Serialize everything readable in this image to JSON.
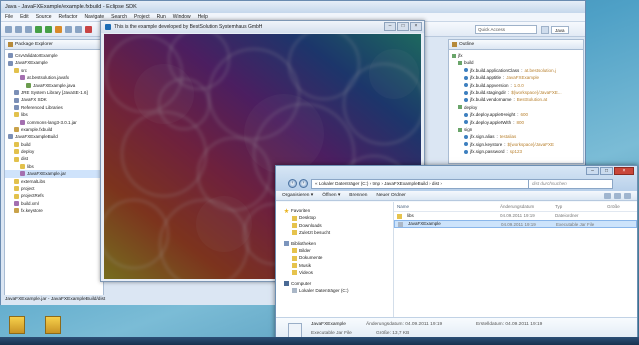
{
  "colors": {
    "eclipse_chrome": "#dbe6f3",
    "selection": "#cce3fb",
    "canvas_bg": "#000000",
    "desktop": "#4ea0c6"
  },
  "eclipse": {
    "title": "Java - JavaFXExample/example.fxbuild - Eclipse SDK",
    "menu": [
      "File",
      "Edit",
      "Source",
      "Refactor",
      "Navigate",
      "Search",
      "Project",
      "Run",
      "Window",
      "Help"
    ],
    "quick_access": "Quick Access",
    "perspective_label": "Java",
    "package_explorer": {
      "title": "Package Explorer",
      "items": [
        {
          "label": "CsvValidatorExample",
          "indent": 0,
          "icon": "project"
        },
        {
          "label": "JavaFXExample",
          "indent": 0,
          "icon": "project"
        },
        {
          "label": "src",
          "indent": 1,
          "icon": "folder"
        },
        {
          "label": "at.bestsolution.javafx",
          "indent": 2,
          "icon": "package"
        },
        {
          "label": "JavaFXExample.java",
          "indent": 3,
          "icon": "java"
        },
        {
          "label": "JRE System Library [JavaSE-1.6]",
          "indent": 1,
          "icon": "library"
        },
        {
          "label": "JavaFX SDK",
          "indent": 1,
          "icon": "library"
        },
        {
          "label": "Referenced Libraries",
          "indent": 1,
          "icon": "library"
        },
        {
          "label": "libs",
          "indent": 1,
          "icon": "folder"
        },
        {
          "label": "commons-lang3-3.0.1.jar",
          "indent": 2,
          "icon": "jar"
        },
        {
          "label": "example.fxbuild",
          "indent": 1,
          "icon": "file"
        },
        {
          "label": "JavaFXExampleBuild",
          "indent": 0,
          "icon": "project"
        },
        {
          "label": "build",
          "indent": 1,
          "icon": "folder"
        },
        {
          "label": "deploy",
          "indent": 1,
          "icon": "folder"
        },
        {
          "label": "dist",
          "indent": 1,
          "icon": "folder"
        },
        {
          "label": "libs",
          "indent": 2,
          "icon": "folder"
        },
        {
          "label": "JavaFXExample.jar",
          "indent": 2,
          "icon": "jar",
          "selected": true
        },
        {
          "label": "externalLibs",
          "indent": 1,
          "icon": "folder"
        },
        {
          "label": "project",
          "indent": 1,
          "icon": "folder"
        },
        {
          "label": "projectRefs",
          "indent": 1,
          "icon": "folder"
        },
        {
          "label": "build.xml",
          "indent": 1,
          "icon": "xml"
        },
        {
          "label": "fx.keystore",
          "indent": 1,
          "icon": "file"
        }
      ]
    },
    "outline": {
      "title": "Outline",
      "items": [
        {
          "label": "jfx",
          "value": "",
          "indent": 0,
          "node": true
        },
        {
          "label": "build",
          "value": "",
          "indent": 1,
          "node": true
        },
        {
          "label": "jfx.build.applicationClass",
          "value": "at.bestsolution.j",
          "indent": 2
        },
        {
          "label": "jfx.build.apptitle",
          "value": "JavaFXExample",
          "indent": 2
        },
        {
          "label": "jfx.build.appversion",
          "value": "1.0.0",
          "indent": 2
        },
        {
          "label": "jfx.build.stagingdir",
          "value": "${workspace}/JavaFXE...",
          "indent": 2
        },
        {
          "label": "jfx.build.vendorname",
          "value": "BestSolution.at",
          "indent": 2
        },
        {
          "label": "deploy",
          "value": "",
          "indent": 1,
          "node": true
        },
        {
          "label": "jfx.deploy.appletHeight",
          "value": "600",
          "indent": 2
        },
        {
          "label": "jfx.deploy.appletWith",
          "value": "800",
          "indent": 2
        },
        {
          "label": "sign",
          "value": "",
          "indent": 1,
          "node": true
        },
        {
          "label": "jfx.sign.alias",
          "value": "testalias",
          "indent": 2
        },
        {
          "label": "jfx.sign.keystore",
          "value": "${workspace}/JavaFXE",
          "indent": 2
        },
        {
          "label": "jfx.sign.password",
          "value": "sp123",
          "indent": 2
        }
      ]
    },
    "status": "JavaFXExample.jar - JavaFXExampleBuild/dist"
  },
  "fxwindow": {
    "title": "This is the example developed by BestSolution Systemhaus GmbH",
    "min_glyph": "–",
    "max_glyph": "□",
    "close_glyph": "×"
  },
  "explorer": {
    "address": "« Lokaler Datenträger (C:) › tmp › JavaFXExampleBuild › dist ›",
    "search_placeholder": "dist durchsuchen",
    "commands": [
      "Organisieren ▾",
      "Öffnen ▾",
      "Brennen",
      "Neuer Ordner"
    ],
    "nav_pane": [
      {
        "label": "Favoriten",
        "icon": "star",
        "head": true
      },
      {
        "label": "Desktop",
        "icon": "folder"
      },
      {
        "label": "Downloads",
        "icon": "folder"
      },
      {
        "label": "Zuletzt besucht",
        "icon": "folder"
      },
      {
        "label": "Bibliotheken",
        "icon": "lib",
        "head": true
      },
      {
        "label": "Bilder",
        "icon": "folder"
      },
      {
        "label": "Dokumente",
        "icon": "folder"
      },
      {
        "label": "Musik",
        "icon": "folder"
      },
      {
        "label": "Videos",
        "icon": "folder"
      },
      {
        "label": "Computer",
        "icon": "pc",
        "head": true
      },
      {
        "label": "Lokaler Datenträger (C:)",
        "icon": "drive"
      }
    ],
    "columns": [
      "Name",
      "Änderungsdatum",
      "Typ",
      "Größe"
    ],
    "files": [
      {
        "name": "libs",
        "date": "04.09.2011 19:19",
        "type": "Dateiordner",
        "size": "",
        "selected": false
      },
      {
        "name": "JavaFXExample",
        "date": "04.09.2011 19:19",
        "type": "Executable Jar File",
        "size": "",
        "selected": true
      }
    ],
    "details": {
      "name": "JavaFXExample",
      "type": "Executable Jar File",
      "modified": "Änderungsdatum: 04.09.2011 19:19",
      "size": "Größe: 13,7 KB",
      "created": "Erstelldatum: 04.09.2011 19:19"
    }
  },
  "desktop_icons": [
    {
      "label": "...",
      "x_hint": "left"
    },
    {
      "label": "...",
      "x_hint": "second"
    }
  ]
}
